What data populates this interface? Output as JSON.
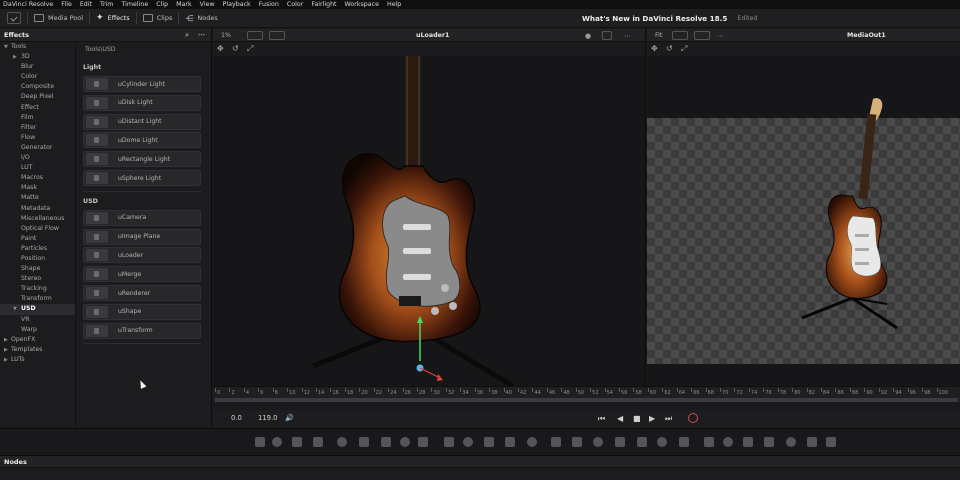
{
  "menubar": {
    "items": [
      "DaVinci Resolve",
      "File",
      "Edit",
      "Trim",
      "Timeline",
      "Clip",
      "Mark",
      "View",
      "Playback",
      "Fusion",
      "Color",
      "Fairlight",
      "Workspace",
      "Help"
    ]
  },
  "toolbar": {
    "media_pool": "Media Pool",
    "effects": "Effects",
    "clips": "Clips",
    "nodes": "Nodes"
  },
  "project": {
    "title": "What's New in DaVinci Resolve 18.5",
    "status": "Edited"
  },
  "effects_panel": {
    "title": "Effects",
    "breadcrumb": "Tools\\USD",
    "tree": [
      {
        "label": "Tools",
        "level": 0,
        "expanded": true
      },
      {
        "label": "3D",
        "level": 1,
        "arrow": true
      },
      {
        "label": "Blur",
        "level": 1
      },
      {
        "label": "Color",
        "level": 1
      },
      {
        "label": "Composite",
        "level": 1
      },
      {
        "label": "Deep Pixel",
        "level": 1
      },
      {
        "label": "Effect",
        "level": 1
      },
      {
        "label": "Film",
        "level": 1
      },
      {
        "label": "Filter",
        "level": 1
      },
      {
        "label": "Flow",
        "level": 1
      },
      {
        "label": "Generator",
        "level": 1
      },
      {
        "label": "I/O",
        "level": 1
      },
      {
        "label": "LUT",
        "level": 1
      },
      {
        "label": "Macros",
        "level": 1
      },
      {
        "label": "Mask",
        "level": 1
      },
      {
        "label": "Matte",
        "level": 1
      },
      {
        "label": "Metadata",
        "level": 1
      },
      {
        "label": "Miscellaneous",
        "level": 1
      },
      {
        "label": "Optical Flow",
        "level": 1
      },
      {
        "label": "Paint",
        "level": 1
      },
      {
        "label": "Particles",
        "level": 1
      },
      {
        "label": "Position",
        "level": 1
      },
      {
        "label": "Shape",
        "level": 1
      },
      {
        "label": "Stereo",
        "level": 1
      },
      {
        "label": "Tracking",
        "level": 1
      },
      {
        "label": "Transform",
        "level": 1
      },
      {
        "label": "USD",
        "level": 1,
        "arrow": true,
        "selected": true
      },
      {
        "label": "VR",
        "level": 1
      },
      {
        "label": "Warp",
        "level": 1
      },
      {
        "label": "OpenFX",
        "level": 0,
        "arrow": true
      },
      {
        "label": "Templates",
        "level": 0,
        "arrow": true
      },
      {
        "label": "LUTs",
        "level": 0,
        "arrow": true
      }
    ],
    "sections": [
      {
        "label": "Light",
        "items": [
          "uCylinder Light",
          "uDisk Light",
          "uDistant Light",
          "uDome Light",
          "uRectangle Light",
          "uSphere Light"
        ]
      },
      {
        "label": "USD",
        "items": [
          "uCamera",
          "uImage Plane",
          "uLoader",
          "uMerge",
          "uRenderer",
          "uShape",
          "uTransform"
        ]
      }
    ]
  },
  "viewer_left": {
    "name": "uLoader1",
    "zoom": "1%"
  },
  "viewer_right": {
    "name": "MediaOut1",
    "zoom": "Fit"
  },
  "timeline": {
    "ticks": [
      "0",
      "2",
      "4",
      "6",
      "8",
      "10",
      "12",
      "14",
      "16",
      "18",
      "20",
      "22",
      "24",
      "26",
      "28",
      "30",
      "32",
      "34",
      "36",
      "38",
      "40",
      "42",
      "44",
      "46",
      "48",
      "50",
      "52",
      "54",
      "56",
      "58",
      "60",
      "62",
      "64",
      "66",
      "68",
      "70",
      "72",
      "74",
      "76",
      "78",
      "80",
      "82",
      "84",
      "86",
      "88",
      "90",
      "92",
      "94",
      "96",
      "98",
      "100"
    ],
    "current_frame": "0.0",
    "end_frame": "119.0"
  },
  "nodes_panel": {
    "title": "Nodes"
  }
}
